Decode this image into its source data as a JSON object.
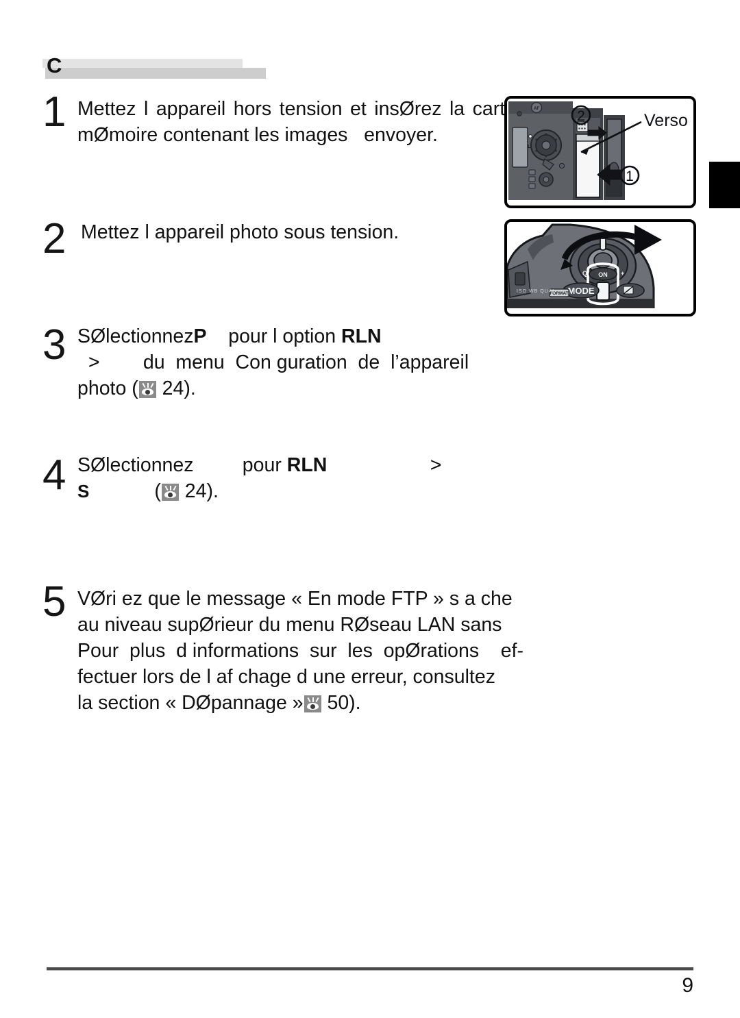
{
  "document": {
    "language": "fr",
    "page_number": "9",
    "section_marker": "C"
  },
  "header": {
    "letter": "C",
    "redacted": true
  },
  "steps": [
    {
      "number": "1",
      "lines": [
        "Mettez l appareil hors tension et insØrez la carte",
        "mØmoire contenant les images   envoyer."
      ]
    },
    {
      "number": "2",
      "lines": [
        "Mettez l appareil photo sous tension."
      ]
    },
    {
      "number": "3",
      "lines": [
        "SØlectionnez ",
        "P",
        "  pour l option ",
        "RLN",
        ">",
        "du  menu  Con guration  de  l’appareil",
        "photo (",
        "24)."
      ],
      "line1_pre": "SØlectionnez",
      "line1_bold1": "P",
      "line1_mid": "pour l option",
      "line1_bold2": "RLN",
      "line2_gt": ">",
      "line2_rest": "du  menu  Con guration  de  l’appareil",
      "line3_pre": "photo (",
      "line3_ref": "24)."
    },
    {
      "number": "4",
      "line1_pre": "SØlectionnez",
      "line1_mid": "pour",
      "line1_bold": "RLN",
      "line1_gt": ">",
      "line2_s": "S",
      "line2_ref": "24)."
    },
    {
      "number": "5",
      "lines": [
        "VØri ez que le message « En mode FTP » s a che",
        "au niveau supØrieur du menu RØseau LAN sans",
        "Pour  plus  d informations  sur  les  opØrations    ef-",
        "fectuer lors de l af chage d une erreur, consultez",
        "la section « DØpannage »"
      ],
      "last_line_pre": "la section « DØpannage »",
      "last_line_ref": "50)."
    }
  ],
  "figures": [
    {
      "name": "memory-card-insertion",
      "caption": "Verso",
      "callouts": [
        "②",
        "①"
      ]
    },
    {
      "name": "power-switch",
      "labels": [
        "ON",
        "MODE",
        "FORMAT"
      ]
    }
  ],
  "colors": {
    "band_upper": "#e3e3e3",
    "band_lower": "#cdcdcd",
    "ref_icon": "#8a8a8a",
    "footer_rule": "#4a4a4a",
    "thumb_tab": "#000000",
    "text": "#111111"
  }
}
